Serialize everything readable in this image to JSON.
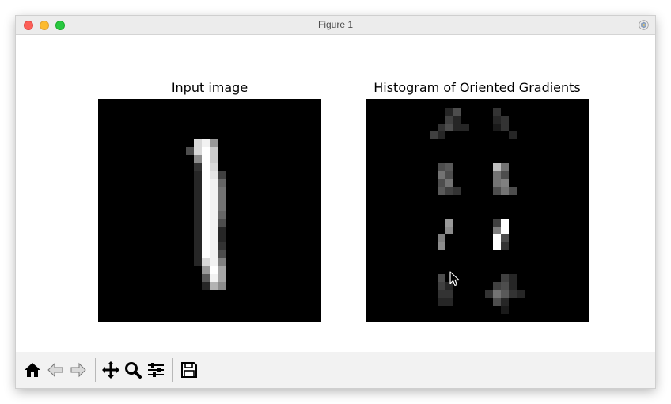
{
  "window": {
    "title": "Figure 1"
  },
  "plots": [
    {
      "title": "Input image",
      "cells": [
        [
          12,
          5,
          0.85
        ],
        [
          13,
          5,
          0.95
        ],
        [
          14,
          5,
          0.6
        ],
        [
          11,
          6,
          0.3
        ],
        [
          12,
          6,
          0.85
        ],
        [
          13,
          6,
          1.0
        ],
        [
          14,
          6,
          0.8
        ],
        [
          12,
          7,
          0.55
        ],
        [
          13,
          7,
          1.0
        ],
        [
          14,
          7,
          0.8
        ],
        [
          12,
          8,
          0.2
        ],
        [
          13,
          8,
          1.0
        ],
        [
          14,
          8,
          0.85
        ],
        [
          12,
          9,
          0.15
        ],
        [
          13,
          9,
          1.0
        ],
        [
          14,
          9,
          0.9
        ],
        [
          15,
          9,
          0.25
        ],
        [
          12,
          10,
          0.15
        ],
        [
          13,
          10,
          1.0
        ],
        [
          14,
          10,
          0.95
        ],
        [
          15,
          10,
          0.4
        ],
        [
          12,
          11,
          0.15
        ],
        [
          13,
          11,
          1.0
        ],
        [
          14,
          11,
          0.95
        ],
        [
          15,
          11,
          0.45
        ],
        [
          12,
          12,
          0.15
        ],
        [
          13,
          12,
          1.0
        ],
        [
          14,
          12,
          0.95
        ],
        [
          15,
          12,
          0.45
        ],
        [
          12,
          13,
          0.15
        ],
        [
          13,
          13,
          1.0
        ],
        [
          14,
          13,
          0.95
        ],
        [
          15,
          13,
          0.45
        ],
        [
          12,
          14,
          0.15
        ],
        [
          13,
          14,
          1.0
        ],
        [
          14,
          14,
          0.95
        ],
        [
          15,
          14,
          0.4
        ],
        [
          12,
          15,
          0.15
        ],
        [
          13,
          15,
          1.0
        ],
        [
          14,
          15,
          0.95
        ],
        [
          15,
          15,
          0.3
        ],
        [
          12,
          16,
          0.15
        ],
        [
          13,
          16,
          1.0
        ],
        [
          14,
          16,
          0.95
        ],
        [
          15,
          16,
          0.15
        ],
        [
          12,
          17,
          0.15
        ],
        [
          13,
          17,
          1.0
        ],
        [
          14,
          17,
          0.95
        ],
        [
          15,
          17,
          0.15
        ],
        [
          12,
          18,
          0.15
        ],
        [
          13,
          18,
          1.0
        ],
        [
          14,
          18,
          0.95
        ],
        [
          15,
          18,
          0.2
        ],
        [
          12,
          19,
          0.15
        ],
        [
          13,
          19,
          1.0
        ],
        [
          14,
          19,
          0.95
        ],
        [
          15,
          19,
          0.3
        ],
        [
          12,
          20,
          0.15
        ],
        [
          13,
          20,
          0.85
        ],
        [
          14,
          20,
          0.95
        ],
        [
          15,
          20,
          0.5
        ],
        [
          13,
          21,
          0.6
        ],
        [
          14,
          21,
          1.0
        ],
        [
          15,
          21,
          0.65
        ],
        [
          13,
          22,
          0.35
        ],
        [
          14,
          22,
          0.95
        ],
        [
          15,
          22,
          0.65
        ],
        [
          13,
          23,
          0.15
        ],
        [
          14,
          23,
          0.7
        ],
        [
          15,
          23,
          0.55
        ]
      ]
    },
    {
      "title": "Histogram of Oriented Gradients",
      "cells": [
        [
          10,
          1,
          0.15
        ],
        [
          11,
          1,
          0.3
        ],
        [
          10,
          2,
          0.25
        ],
        [
          11,
          2,
          0.15
        ],
        [
          9,
          3,
          0.2
        ],
        [
          10,
          3,
          0.3
        ],
        [
          11,
          3,
          0.15
        ],
        [
          12,
          3,
          0.15
        ],
        [
          8,
          4,
          0.25
        ],
        [
          9,
          4,
          0.15
        ],
        [
          16,
          1,
          0.2
        ],
        [
          16,
          2,
          0.15
        ],
        [
          17,
          2,
          0.2
        ],
        [
          16,
          3,
          0.1
        ],
        [
          17,
          3,
          0.2
        ],
        [
          18,
          4,
          0.15
        ],
        [
          9,
          8,
          0.3
        ],
        [
          10,
          8,
          0.35
        ],
        [
          9,
          9,
          0.45
        ],
        [
          10,
          9,
          0.3
        ],
        [
          9,
          10,
          0.3
        ],
        [
          10,
          10,
          0.45
        ],
        [
          9,
          11,
          0.35
        ],
        [
          10,
          11,
          0.25
        ],
        [
          11,
          11,
          0.2
        ],
        [
          16,
          8,
          0.75
        ],
        [
          17,
          8,
          0.45
        ],
        [
          16,
          9,
          0.45
        ],
        [
          17,
          9,
          0.3
        ],
        [
          16,
          10,
          0.45
        ],
        [
          17,
          10,
          0.5
        ],
        [
          16,
          11,
          0.3
        ],
        [
          17,
          11,
          0.45
        ],
        [
          18,
          11,
          0.3
        ],
        [
          10,
          15,
          0.6
        ],
        [
          10,
          16,
          0.55
        ],
        [
          9,
          17,
          0.5
        ],
        [
          9,
          18,
          0.55
        ],
        [
          16,
          15,
          0.25
        ],
        [
          17,
          15,
          1.0
        ],
        [
          16,
          16,
          0.5
        ],
        [
          17,
          16,
          1.0
        ],
        [
          16,
          17,
          1.0
        ],
        [
          17,
          17,
          0.3
        ],
        [
          16,
          18,
          1.0
        ],
        [
          17,
          18,
          0.2
        ],
        [
          9,
          22,
          0.3
        ],
        [
          9,
          23,
          0.25
        ],
        [
          10,
          23,
          0.15
        ],
        [
          9,
          24,
          0.2
        ],
        [
          10,
          24,
          0.2
        ],
        [
          9,
          25,
          0.15
        ],
        [
          10,
          25,
          0.15
        ],
        [
          17,
          22,
          0.25
        ],
        [
          18,
          22,
          0.15
        ],
        [
          16,
          23,
          0.25
        ],
        [
          17,
          23,
          0.3
        ],
        [
          18,
          23,
          0.15
        ],
        [
          15,
          24,
          0.2
        ],
        [
          16,
          24,
          0.45
        ],
        [
          17,
          24,
          0.35
        ],
        [
          18,
          24,
          0.2
        ],
        [
          19,
          24,
          0.15
        ],
        [
          16,
          25,
          0.3
        ],
        [
          17,
          25,
          0.15
        ],
        [
          17,
          26,
          0.1
        ]
      ]
    }
  ],
  "toolbar": [
    {
      "id": "home",
      "icon": "home-icon"
    },
    {
      "id": "back",
      "icon": "back-arrow-icon"
    },
    {
      "id": "forward",
      "icon": "forward-arrow-icon"
    },
    {
      "id": "pan",
      "icon": "pan-move-icon"
    },
    {
      "id": "zoom",
      "icon": "zoom-magnifier-icon"
    },
    {
      "id": "configure",
      "icon": "configure-subplots-icon"
    },
    {
      "id": "save",
      "icon": "save-floppy-icon"
    }
  ]
}
